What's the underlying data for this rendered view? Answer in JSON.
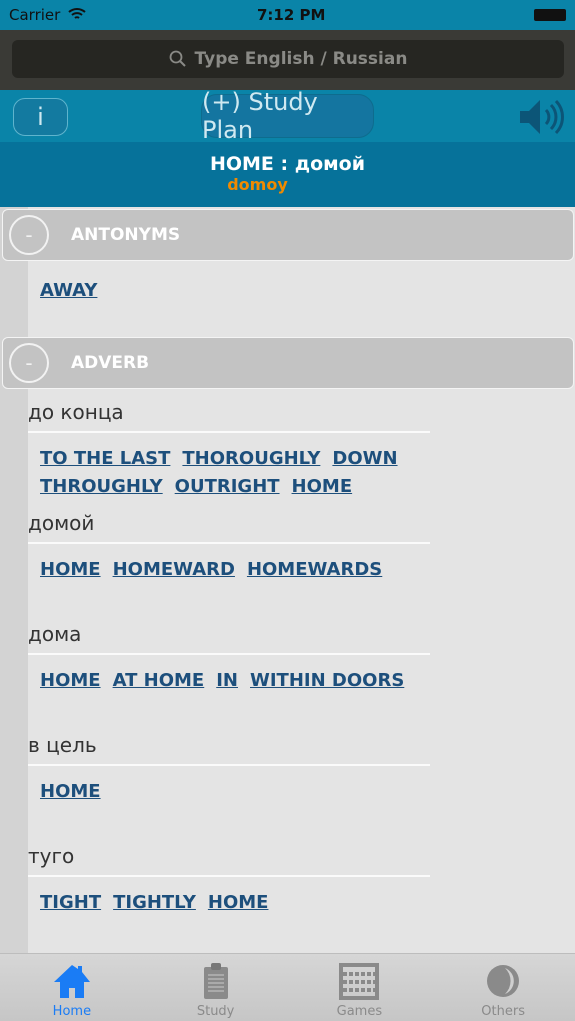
{
  "status": {
    "carrier": "Carrier",
    "time": "7:12 PM"
  },
  "search": {
    "placeholder": "Type English / Russian"
  },
  "toolbar": {
    "info_label": "i",
    "study_plan_label": "(+) Study Plan"
  },
  "word": {
    "title": "HOME : домой",
    "transliteration": "domoy"
  },
  "sections": [
    {
      "label": "ANTONYMS",
      "collapse": "-",
      "groups": [
        {
          "russian": "",
          "links": [
            "AWAY"
          ]
        }
      ]
    },
    {
      "label": "ADVERB",
      "collapse": "-",
      "groups": [
        {
          "russian": "до конца",
          "links": [
            "TO THE LAST",
            "THOROUGHLY",
            "DOWN",
            "THROUGHLY",
            "OUTRIGHT",
            "HOME"
          ]
        },
        {
          "russian": "домой",
          "links": [
            "HOME",
            "HOMEWARD",
            "HOMEWARDS"
          ]
        },
        {
          "russian": "дома",
          "links": [
            "HOME",
            "AT HOME",
            "IN",
            "WITHIN DOORS"
          ]
        },
        {
          "russian": "в цель",
          "links": [
            "HOME"
          ]
        },
        {
          "russian": "туго",
          "links": [
            "TIGHT",
            "TIGHTLY",
            "HOME"
          ]
        }
      ]
    }
  ],
  "tabs": [
    {
      "label": "Home",
      "icon": "home-icon",
      "active": true
    },
    {
      "label": "Study",
      "icon": "clipboard-icon"
    },
    {
      "label": "Games",
      "icon": "abacus-icon"
    },
    {
      "label": "Others",
      "icon": "moon-icon"
    }
  ],
  "colors": {
    "accent": "#0a84a8",
    "active_tab": "#1a7cf5",
    "link": "#1d4f7c",
    "transliteration": "#f08a00"
  }
}
